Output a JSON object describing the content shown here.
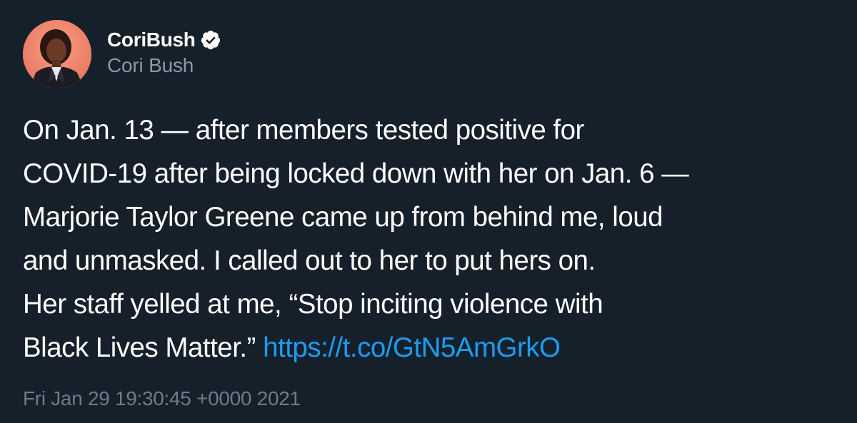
{
  "tweet": {
    "display_name": "CoriBush",
    "handle": "Cori Bush",
    "verified_icon": "verified-badge-icon",
    "avatar_icon": "profile-photo",
    "body_lines": [
      "On Jan. 13 — after members tested positive for",
      "COVID-19 after being locked down with her on Jan. 6 —",
      "Marjorie Taylor Greene came up from behind me, loud",
      "and unmasked. I called out to her to put hers on.",
      "Her staff yelled at me, “Stop inciting violence with",
      "Black Lives Matter.”"
    ],
    "link_text": "https://t.co/GtN5AmGrkO",
    "timestamp": "Fri Jan 29 19:30:45 +0000 2021",
    "colors": {
      "background": "#15202b",
      "text": "#ffffff",
      "secondary": "#8b98a5",
      "link": "#1d9bf0"
    }
  }
}
